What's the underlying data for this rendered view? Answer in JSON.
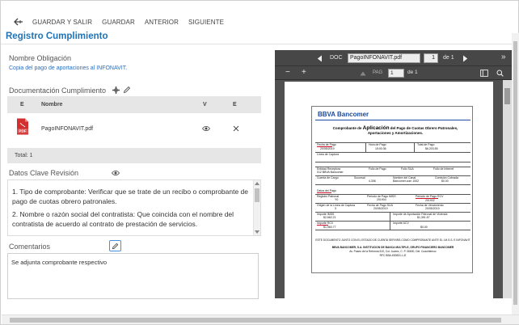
{
  "toolbar": {
    "back_icon": "back-arrow-icon",
    "save_exit": "GUARDAR Y SALIR",
    "save": "GUARDAR",
    "prev": "ANTERIOR",
    "next": "SIGUIENTE"
  },
  "page_title": "Registro Cumplimiento",
  "obligation": {
    "label": "Nombre Obligación",
    "value": "Copia del pago de aportaciones al INFONAVIT."
  },
  "documents": {
    "label": "Documentación Cumplimiento",
    "columns": [
      "E",
      "Nombre",
      "V",
      "E"
    ],
    "rows": [
      {
        "file_icon": "pdf-file-icon",
        "file_badge": "PDF",
        "name": "PagoINFONAVIT.pdf",
        "view_icon": "eye-icon",
        "delete_icon": "close-icon"
      }
    ],
    "total": "Total: 1"
  },
  "review": {
    "label": "Datos Clave Revisión",
    "p1": "1. Tipo de comprobante: Verificar que se trate de un recibo o comprobante de pago de cuotas obrero patronales.",
    "p2": "2. Nombre o razón social del contratista: Que coincida con el  nombre del contratista de acuerdo al contrato de prestación de servicios."
  },
  "comments": {
    "label": "Comentarios",
    "value": "Se adjunta comprobante respectivo"
  },
  "viewer": {
    "doc_label": "DOC",
    "file": "PagoINFONAVIT.pdf",
    "doc_page": "1",
    "doc_of": "de 1",
    "pag_label": "PAG",
    "page": "1",
    "page_of": "de 1",
    "zoom_out": "−",
    "zoom_in": "+",
    "expand": "»"
  },
  "receipt": {
    "brand": "BBVA Bancomer",
    "heading_pre": "Comprobante de ",
    "heading_big": "Aplicación",
    "heading_post": " del Pago de Cuotas Obrero Patronales, Aportaciones y Amortizaciones.",
    "fecha_pago_l": "Fecha de Pago",
    "fecha_pago_v": "20/05/2019",
    "hora_pago_l": "Hora de Pago",
    "hora_pago_v": "15:00:36",
    "total_pago_l": "Total de Pago",
    "total_pago_v": "$6,203.55",
    "linea_captura": "Línea de Captura",
    "entidad_l": "Entidad Receptora",
    "entidad_v": "012 BBVA Bancomer",
    "folio_pago": "Folio de Pago",
    "folio_sua": "Folio SUA",
    "folio_internet": "Folio de Internet",
    "cuenta_cargo": "Cuenta de Cargo",
    "sucursal_l": "Sucursal",
    "sucursal_v": "4,306",
    "nombre_cuenta": "Nombre del Canal",
    "nombre_cuenta_v": "Bancomer.com 1002",
    "comision": "Comisión Cobrada",
    "comision_v": "$0.00",
    "datos_pago": "Datos del Pago",
    "registro_patronal_l": "Registro Patronal",
    "registro_patronal_v": "Y0",
    "periodo_imss_l": "Periodo de Pago IMSS",
    "periodo_imss_v": "201904",
    "periodo_rcv_l": "Periodo de Pago RCV",
    "periodo_rcv_v": "201902",
    "origen_l": "Origen de la Línea de Captura",
    "origen_v": "3",
    "fecha_limite_l": "Fecha de Pago SUA",
    "fecha_limite_v": "20/05/2019",
    "vencimiento_l": "Fecha de Vencimiento",
    "vencimiento_v": "20/05/2019",
    "imss_l": "Importe IMSS",
    "imss_v": "$2,662.21",
    "infonavit_l": "Importe de Aportación Patronal de Vivienda",
    "infonavit_v": "$1,391.57",
    "rcv_l": "Importe RCV",
    "rcv_v": "$1,960.77",
    "acv_l": "Importe ACV",
    "acv_v": "$0.00",
    "foot1": "ESTE DOCUMENTO JUNTO CON EL ESTADO DE CUENTA SERVIRÁ COMO COMPROBANTE ANTE EL I.M.S.S. E INFONAVIT",
    "foot2": "BBVA BANCOMER, S.A. INSTITUCION DE BANCA MULTIPLE, GRUPO FINANCIERO BANCOMER",
    "foot3": "Av. Paseo de la Reforma 510, Col. Juárez, C. P. 06600, Del. Cuauhtémoc",
    "foot4": "RFC BBA-830831-LJ2"
  },
  "colors": {
    "accent": "#1f73b7",
    "link": "#2a6ebb",
    "pdf_red": "#d32f2f",
    "viewer_bg": "#3d3d3d"
  }
}
